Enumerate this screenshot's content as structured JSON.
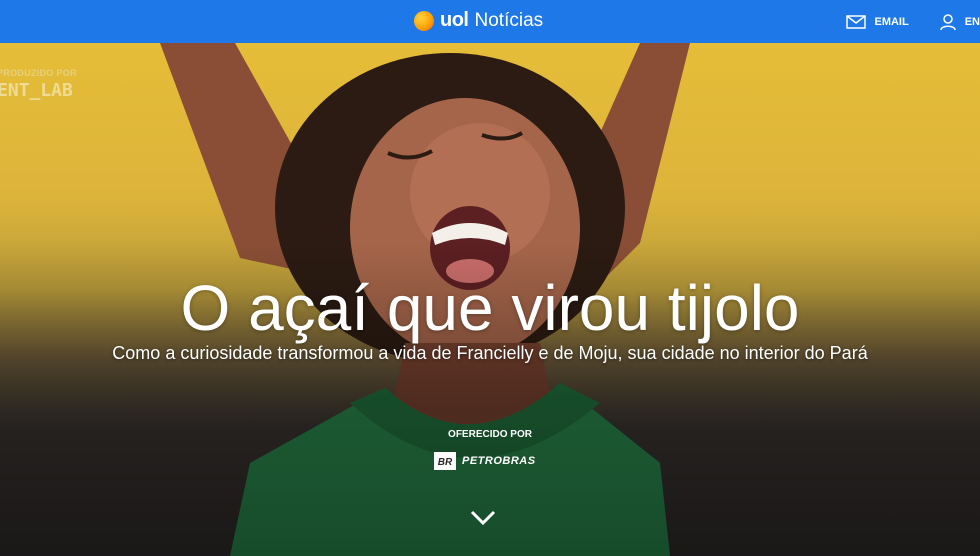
{
  "header": {
    "brand_uol": "uol",
    "brand_section": "Notícias",
    "email_label": "EMAIL",
    "login_label": "EN",
    "color": "#1e78e8"
  },
  "hero": {
    "producer_label": "PRODUZIDO POR",
    "producer_name": "ENT_LAB",
    "title": "O açaí que virou tijolo",
    "subtitle": "Como a curiosidade transformou a vida de Francielly e de Moju, sua cidade no interior do Pará",
    "offered_by": "OFERECIDO POR",
    "sponsor_mark": "BR",
    "sponsor_name": "PETROBRAS"
  },
  "icons": [
    "mail-icon",
    "user-icon",
    "chevron-down-icon"
  ]
}
